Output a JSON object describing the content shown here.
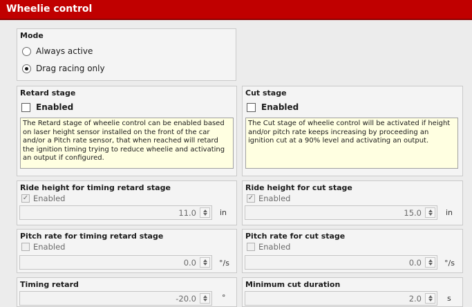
{
  "window": {
    "title": "Wheelie control"
  },
  "mode": {
    "title": "Mode",
    "options": [
      {
        "label": "Always active",
        "selected": false
      },
      {
        "label": "Drag racing only",
        "selected": true
      }
    ]
  },
  "retard_stage": {
    "title": "Retard stage",
    "enabled_label": "Enabled",
    "enabled": false,
    "description": "The Retard stage of wheelie control can be enabled based on laser height sensor installed on the front of the car and/or a Pitch rate sensor, that when reached will retard the ignition timing trying to reduce wheelie and activating an output if configured."
  },
  "cut_stage": {
    "title": "Cut stage",
    "enabled_label": "Enabled",
    "enabled": false,
    "description": "The Cut stage of wheelie control will be activated if height and/or pitch rate keeps increasing by proceeding an ignition cut at a 90% level and activating an output."
  },
  "ride_height_retard": {
    "title": "Ride height for timing retard stage",
    "enabled_label": "Enabled",
    "enabled": true,
    "value": "11.0",
    "unit": "in"
  },
  "ride_height_cut": {
    "title": "Ride height for cut stage",
    "enabled_label": "Enabled",
    "enabled": true,
    "value": "15.0",
    "unit": "in"
  },
  "pitch_rate_retard": {
    "title": "Pitch rate for timing retard stage",
    "enabled_label": "Enabled",
    "enabled": false,
    "value": "0.0",
    "unit": "°/s"
  },
  "pitch_rate_cut": {
    "title": "Pitch rate for cut stage",
    "enabled_label": "Enabled",
    "enabled": false,
    "value": "0.0",
    "unit": "°/s"
  },
  "timing_retard": {
    "title": "Timing retard",
    "value": "-20.0",
    "unit": "°"
  },
  "minimum_cut_duration": {
    "title": "Minimum cut duration",
    "value": "2.0",
    "unit": "s"
  },
  "icons": {
    "check": "check-icon",
    "spin_up": "chevron-up-icon",
    "spin_down": "chevron-down-icon"
  }
}
